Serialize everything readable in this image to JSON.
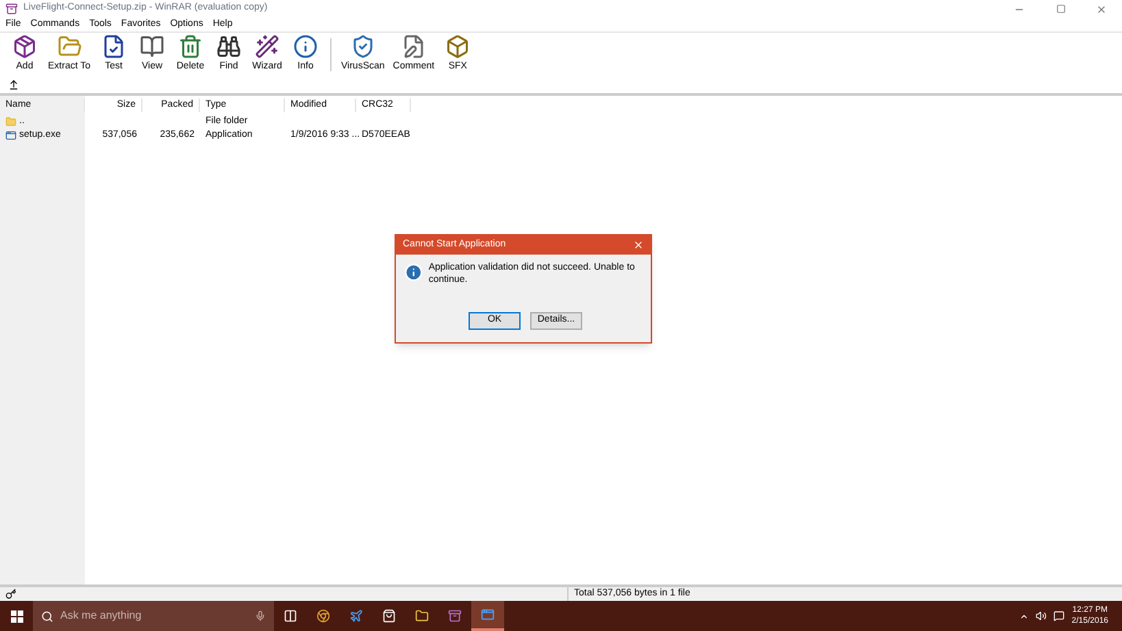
{
  "window": {
    "title": "LiveFlight-Connect-Setup.zip - WinRAR (evaluation copy)"
  },
  "menu": [
    "File",
    "Commands",
    "Tools",
    "Favorites",
    "Options",
    "Help"
  ],
  "toolbar": [
    {
      "label": "Add"
    },
    {
      "label": "Extract To"
    },
    {
      "label": "Test"
    },
    {
      "label": "View"
    },
    {
      "label": "Delete"
    },
    {
      "label": "Find"
    },
    {
      "label": "Wizard"
    },
    {
      "label": "Info"
    },
    {
      "label": "VirusScan"
    },
    {
      "label": "Comment"
    },
    {
      "label": "SFX"
    }
  ],
  "table": {
    "columns": [
      "Name",
      "Size",
      "Packed",
      "Type",
      "Modified",
      "CRC32"
    ],
    "rows": [
      {
        "kind": "folder",
        "cells": [
          "..",
          "",
          "",
          "File folder",
          "",
          ""
        ]
      },
      {
        "kind": "file",
        "cells": [
          "setup.exe",
          "537,056",
          "235,662",
          "Application",
          "1/9/2016 9:33 ...",
          "D570EEAB"
        ]
      }
    ]
  },
  "dialog": {
    "title": "Cannot Start Application",
    "message": "Application validation did not succeed. Unable to continue.",
    "buttons": [
      "OK",
      "Details..."
    ]
  },
  "status_bar": {
    "text": "Total 537,056 bytes in 1 file"
  },
  "taskbar": {
    "search_placeholder": "Ask me anything",
    "apps": [
      {
        "selected": false
      },
      {
        "selected": false
      },
      {
        "selected": false
      },
      {
        "selected": false
      },
      {
        "selected": false
      },
      {
        "selected": false
      },
      {
        "selected": true
      }
    ],
    "time": "12:27 PM",
    "date": "2/15/2016"
  }
}
